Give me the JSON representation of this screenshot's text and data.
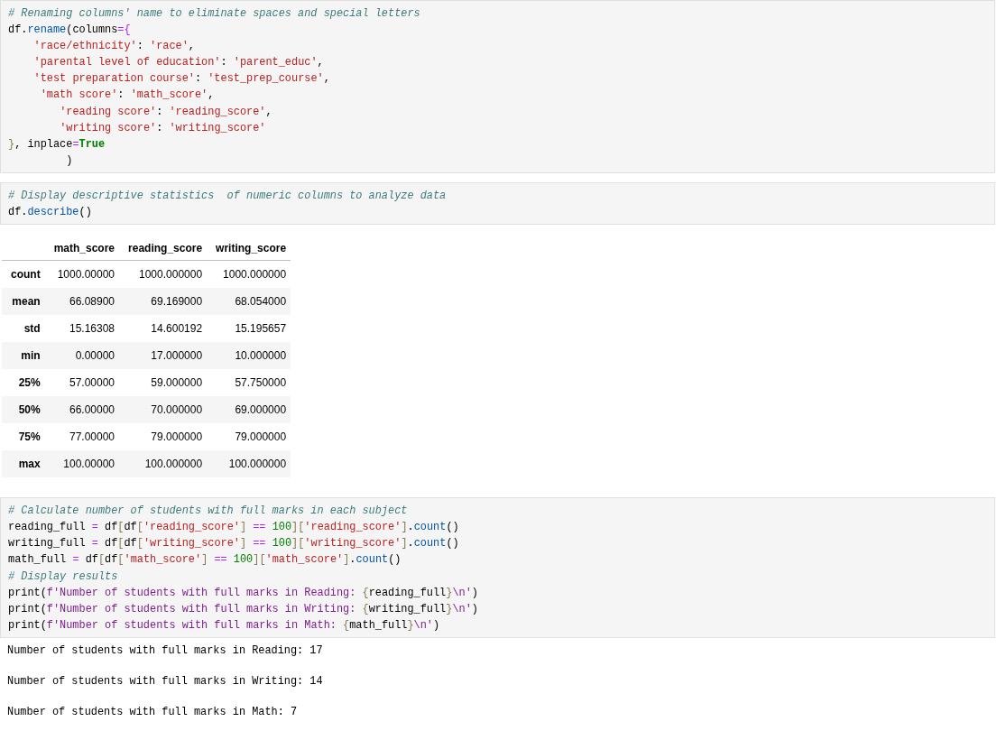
{
  "cells": [
    {
      "kind": "code",
      "lines": [
        "# Renaming columns' name to eliminate spaces and special letters",
        "df.rename(columns={",
        "    'race/ethnicity': 'race',",
        "    'parental level of education': 'parent_educ',",
        "    'test preparation course': 'test_prep_course',",
        "     'math score': 'math_score',",
        "        'reading score': 'reading_score',",
        "        'writing score': 'writing_score'",
        "}, inplace=True",
        "         )"
      ]
    },
    {
      "kind": "code",
      "lines": [
        "# Display descriptive statistics  of numeric columns to analyze data",
        "df.describe()"
      ]
    },
    {
      "kind": "table",
      "columns": [
        "math_score",
        "reading_score",
        "writing_score"
      ],
      "rows": [
        {
          "label": "count",
          "values": [
            "1000.00000",
            "1000.000000",
            "1000.000000"
          ]
        },
        {
          "label": "mean",
          "values": [
            "66.08900",
            "69.169000",
            "68.054000"
          ]
        },
        {
          "label": "std",
          "values": [
            "15.16308",
            "14.600192",
            "15.195657"
          ]
        },
        {
          "label": "min",
          "values": [
            "0.00000",
            "17.000000",
            "10.000000"
          ]
        },
        {
          "label": "25%",
          "values": [
            "57.00000",
            "59.000000",
            "57.750000"
          ]
        },
        {
          "label": "50%",
          "values": [
            "66.00000",
            "70.000000",
            "69.000000"
          ]
        },
        {
          "label": "75%",
          "values": [
            "77.00000",
            "79.000000",
            "79.000000"
          ]
        },
        {
          "label": "max",
          "values": [
            "100.00000",
            "100.000000",
            "100.000000"
          ]
        }
      ]
    },
    {
      "kind": "code",
      "lines": [
        "# Calculate number of students with full marks in each subject",
        "reading_full = df[df['reading_score'] == 100]['reading_score'].count()",
        "writing_full = df[df['writing_score'] == 100]['writing_score'].count()",
        "math_full = df[df['math_score'] == 100]['math_score'].count()",
        "# Display results",
        "print(f'Number of students with full marks in Reading: {reading_full}\\n')",
        "print(f'Number of students with full marks in Writing: {writing_full}\\n')",
        "print(f'Number of students with full marks in Math: {math_full}\\n')"
      ]
    },
    {
      "kind": "output",
      "lines": [
        "Number of students with full marks in Reading: 17",
        "Number of students with full marks in Writing: 14",
        "Number of students with full marks in Math: 7"
      ]
    }
  ]
}
